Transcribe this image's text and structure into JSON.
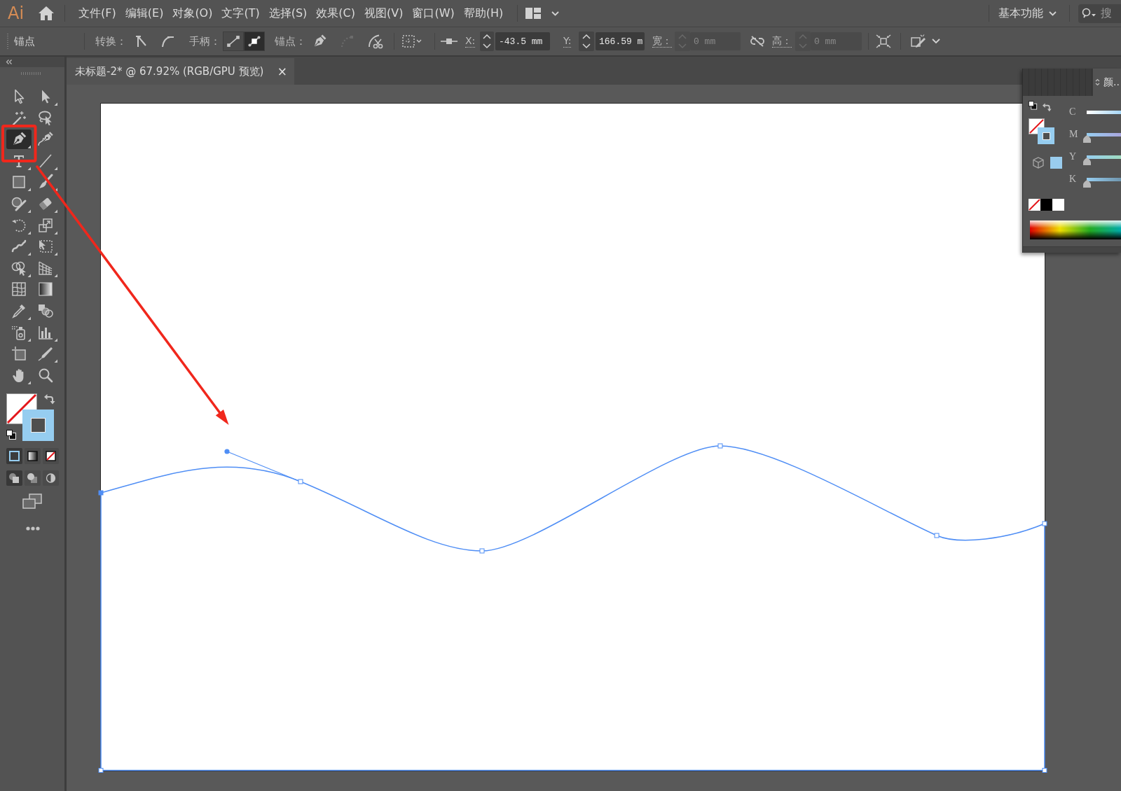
{
  "menu_bar": {
    "logo": "Ai",
    "menus": [
      "文件(F)",
      "编辑(E)",
      "对象(O)",
      "文字(T)",
      "选择(S)",
      "效果(C)",
      "视图(V)",
      "窗口(W)",
      "帮助(H)"
    ],
    "workspace": "基本功能",
    "search": {
      "placeholder": "搜"
    }
  },
  "control_bar": {
    "selection": "锚点",
    "convert_label": "转换：",
    "handles_label": "手柄：",
    "handle_buttons": [
      {
        "selected": false
      },
      {
        "selected": true
      }
    ],
    "anchors_label": "锚点：",
    "fields": [
      {
        "label": "X:",
        "value": "-43.5 mm",
        "disabled": false
      },
      {
        "label": "Y:",
        "value": "166.59 m",
        "disabled": false
      },
      {
        "label": "宽：",
        "value": "0 mm",
        "disabled": true
      },
      {
        "label": "高：",
        "value": "0 mm",
        "disabled": true
      }
    ]
  },
  "document_tab": {
    "title": "未标题-2* @ 67.92% (RGB/GPU 预览)",
    "close": "×"
  },
  "toolbar": {
    "tools": [
      {
        "selected": false
      },
      {
        "selected": false
      },
      {
        "selected": false
      },
      {
        "selected": false
      },
      {
        "selected": true
      },
      {
        "selected": false
      },
      {
        "selected": false
      },
      {
        "selected": false
      },
      {
        "selected": false
      },
      {
        "selected": false
      },
      {
        "selected": false
      },
      {
        "selected": false
      },
      {
        "selected": false
      },
      {
        "selected": false
      },
      {
        "selected": false
      },
      {
        "selected": false
      },
      {
        "selected": false
      },
      {
        "selected": false
      },
      {
        "selected": false
      },
      {
        "selected": false
      },
      {
        "selected": false
      },
      {
        "selected": false
      },
      {
        "selected": false
      },
      {
        "selected": false
      },
      {
        "selected": false
      },
      {
        "selected": false
      },
      {
        "selected": false
      },
      {
        "selected": false
      }
    ],
    "fill_stroke": [
      {
        "kind": "fill",
        "none": true
      },
      {
        "kind": "stroke",
        "color": "#96cdf0"
      }
    ],
    "color_modes": [
      {
        "selected": true
      },
      {
        "selected": false
      },
      {
        "selected": false
      }
    ],
    "draw_modes": [
      {
        "selected": true
      },
      {
        "selected": false
      },
      {
        "selected": false
      }
    ]
  },
  "color_panel": {
    "title": "颜..",
    "fill_stroke": [
      {
        "kind": "fill",
        "none": true
      },
      {
        "kind": "stroke",
        "color": "#96cdf0"
      }
    ],
    "web_safe_swatches": [
      {
        "color": "#99ccee"
      }
    ],
    "channels": [
      {
        "label": "C"
      },
      {
        "label": "M",
        "level": 0
      },
      {
        "label": "Y",
        "level": 0
      },
      {
        "label": "K",
        "level": 0
      }
    ],
    "quick_swatches": [
      {
        "kind": "none"
      },
      {
        "kind": "color",
        "color": "#000000"
      },
      {
        "kind": "color",
        "color": "#ffffff"
      }
    ]
  }
}
